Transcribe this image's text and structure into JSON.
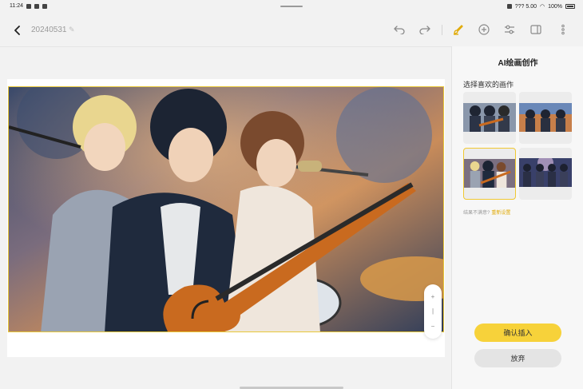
{
  "status_bar": {
    "time": "11:24",
    "signal_text": "??? 5.00",
    "battery_text": "100%"
  },
  "toolbar": {
    "doc_title": "20240531",
    "edit_glyph": "✎",
    "icons": [
      "undo-icon",
      "redo-icon",
      "brush-icon",
      "add-icon",
      "adjust-icon",
      "panel-icon",
      "more-icon"
    ]
  },
  "canvas": {
    "artwork_description_colors": {
      "accent": "#e8c83a"
    },
    "zoom_control": {
      "plus": "+",
      "divider": "|",
      "minus": "−"
    }
  },
  "panel": {
    "title": "AI绘画创作",
    "section_label": "选择喜欢的画作",
    "thumbnails": [
      "thumb-1",
      "thumb-2",
      "thumb-3",
      "thumb-4"
    ],
    "selected_index": 2,
    "hint_text": "结果不满意?",
    "hint_link": "重新设置",
    "confirm_label": "确认插入",
    "discard_label": "放弃"
  },
  "colors": {
    "accent_yellow": "#f7d23a",
    "selection_border": "#e8c83a",
    "panel_bg": "#f7f7f7",
    "button_gray": "#e4e4e4"
  }
}
